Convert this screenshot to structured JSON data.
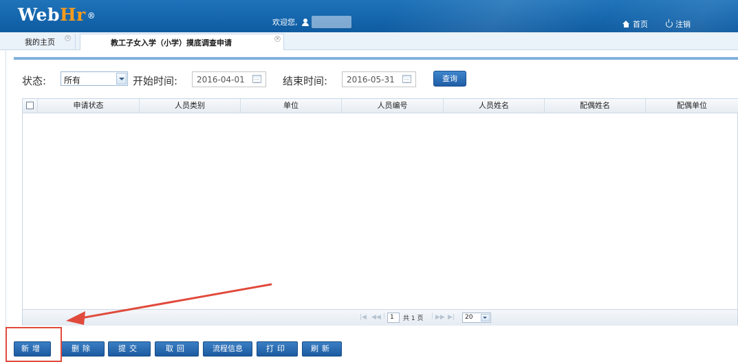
{
  "header": {
    "logo_main": "Web",
    "logo_accent": "Hr",
    "logo_mark": "®",
    "welcome": "欢迎您,",
    "home_link": "首页",
    "logout_link": "注销"
  },
  "tabs": [
    {
      "label": "我的主页",
      "active": false
    },
    {
      "label": "教工子女入学（小学）摸底调查申请",
      "active": true
    }
  ],
  "filters": {
    "status_label": "状态:",
    "status_value": "所有",
    "start_label": "开始时间:",
    "start_date": "2016-04-01",
    "end_label": "结束时间:",
    "end_date": "2016-05-31",
    "query_button": "查询"
  },
  "grid": {
    "columns": [
      "申请状态",
      "人员类别",
      "单位",
      "人员编号",
      "人员姓名",
      "配偶姓名",
      "配偶单位"
    ],
    "rows": []
  },
  "pager": {
    "current_page": "1",
    "total_text": "共 1 页",
    "page_size": "20"
  },
  "toolbar": {
    "add": "新增",
    "delete": "删除",
    "submit": "提交",
    "withdraw": "取回",
    "flow_info": "流程信息",
    "print": "打印",
    "refresh": "刷新"
  },
  "colors": {
    "header_blue": "#1566ad",
    "button_blue": "#1f5da6",
    "logo_accent": "#ff9b1a",
    "annotation_red": "#e04a3c"
  }
}
